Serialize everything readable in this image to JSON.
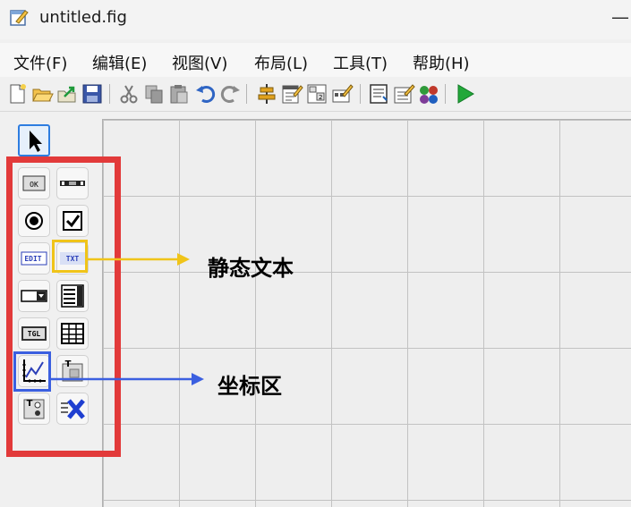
{
  "window": {
    "title": "untitled.fig",
    "minimize": "—"
  },
  "menubar": [
    {
      "label": "文件(F)"
    },
    {
      "label": "编辑(E)"
    },
    {
      "label": "视图(V)"
    },
    {
      "label": "布局(L)"
    },
    {
      "label": "工具(T)"
    },
    {
      "label": "帮助(H)"
    }
  ],
  "toolbar": [
    "new-icon",
    "open-icon",
    "export-icon",
    "save-icon",
    "cut-icon",
    "copy-icon",
    "paste-icon",
    "undo-icon",
    "redo-icon",
    "align-icon",
    "menu-editor-icon",
    "tab-order-icon",
    "toolbar-editor-icon",
    "code-editor-icon",
    "property-inspector-icon",
    "object-browser-icon",
    "run-icon"
  ],
  "palette": {
    "items": [
      {
        "name": "push-button",
        "text": "OK"
      },
      {
        "name": "slider"
      },
      {
        "name": "radio-button"
      },
      {
        "name": "checkbox"
      },
      {
        "name": "edit-text",
        "text": "EDIT"
      },
      {
        "name": "static-text",
        "text": "TXT"
      },
      {
        "name": "popup-menu"
      },
      {
        "name": "listbox"
      },
      {
        "name": "toggle-button",
        "text": "TGL"
      },
      {
        "name": "table"
      },
      {
        "name": "axes"
      },
      {
        "name": "panel",
        "text": "T"
      },
      {
        "name": "button-group",
        "text": "T"
      },
      {
        "name": "activex-control"
      }
    ]
  },
  "annotations": {
    "static_text": "静态文本",
    "axes": "坐标区"
  },
  "colors": {
    "palette_highlight": "#e23a3a",
    "static_text_highlight": "#f0c419",
    "axes_highlight": "#3b5fe0",
    "run_green": "#22a83a"
  }
}
